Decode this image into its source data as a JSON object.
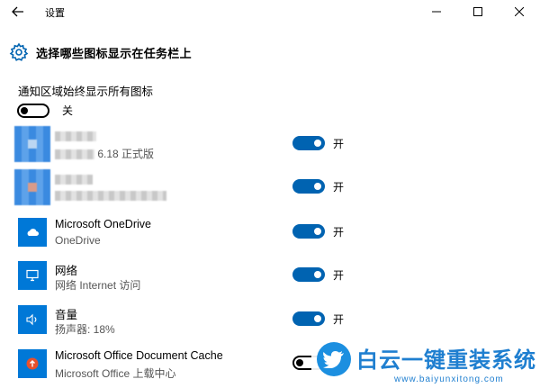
{
  "window": {
    "title": "设置",
    "back_icon": "back-arrow-icon",
    "controls": [
      "minimize-icon",
      "maximize-icon",
      "close-icon"
    ]
  },
  "page": {
    "title": "选择哪些图标显示在任务栏上",
    "icon": "gear-icon"
  },
  "always_show": {
    "label": "通知区域始终显示所有图标",
    "state_label": "关",
    "on": false
  },
  "apps": [
    {
      "name": "",
      "subtitle": "6.18 正式版",
      "state_label": "开",
      "on": true,
      "icon": "blurred-app-icon"
    },
    {
      "name": "",
      "subtitle": "",
      "state_label": "开",
      "on": true,
      "icon": "blurred-app-icon"
    },
    {
      "name": "Microsoft OneDrive",
      "subtitle": "OneDrive",
      "state_label": "开",
      "on": true,
      "icon": "cloud-icon"
    },
    {
      "name": "网络",
      "subtitle": "网络 Internet 访问",
      "state_label": "开",
      "on": true,
      "icon": "network-icon"
    },
    {
      "name": "音量",
      "subtitle": "扬声器: 18%",
      "state_label": "开",
      "on": true,
      "icon": "speaker-icon"
    },
    {
      "name": "Microsoft Office Document Cache",
      "subtitle": "Microsoft Office 上载中心",
      "state_label": "",
      "on": false,
      "icon": "office-upload-icon"
    }
  ],
  "watermark": {
    "brand": "白云一键重装系统",
    "url": "www.baiyunxitong.com",
    "icon": "bird-icon"
  },
  "colors": {
    "accent": "#0063b1",
    "tile": "#0078d7",
    "watermark": "#1f7fd0"
  }
}
